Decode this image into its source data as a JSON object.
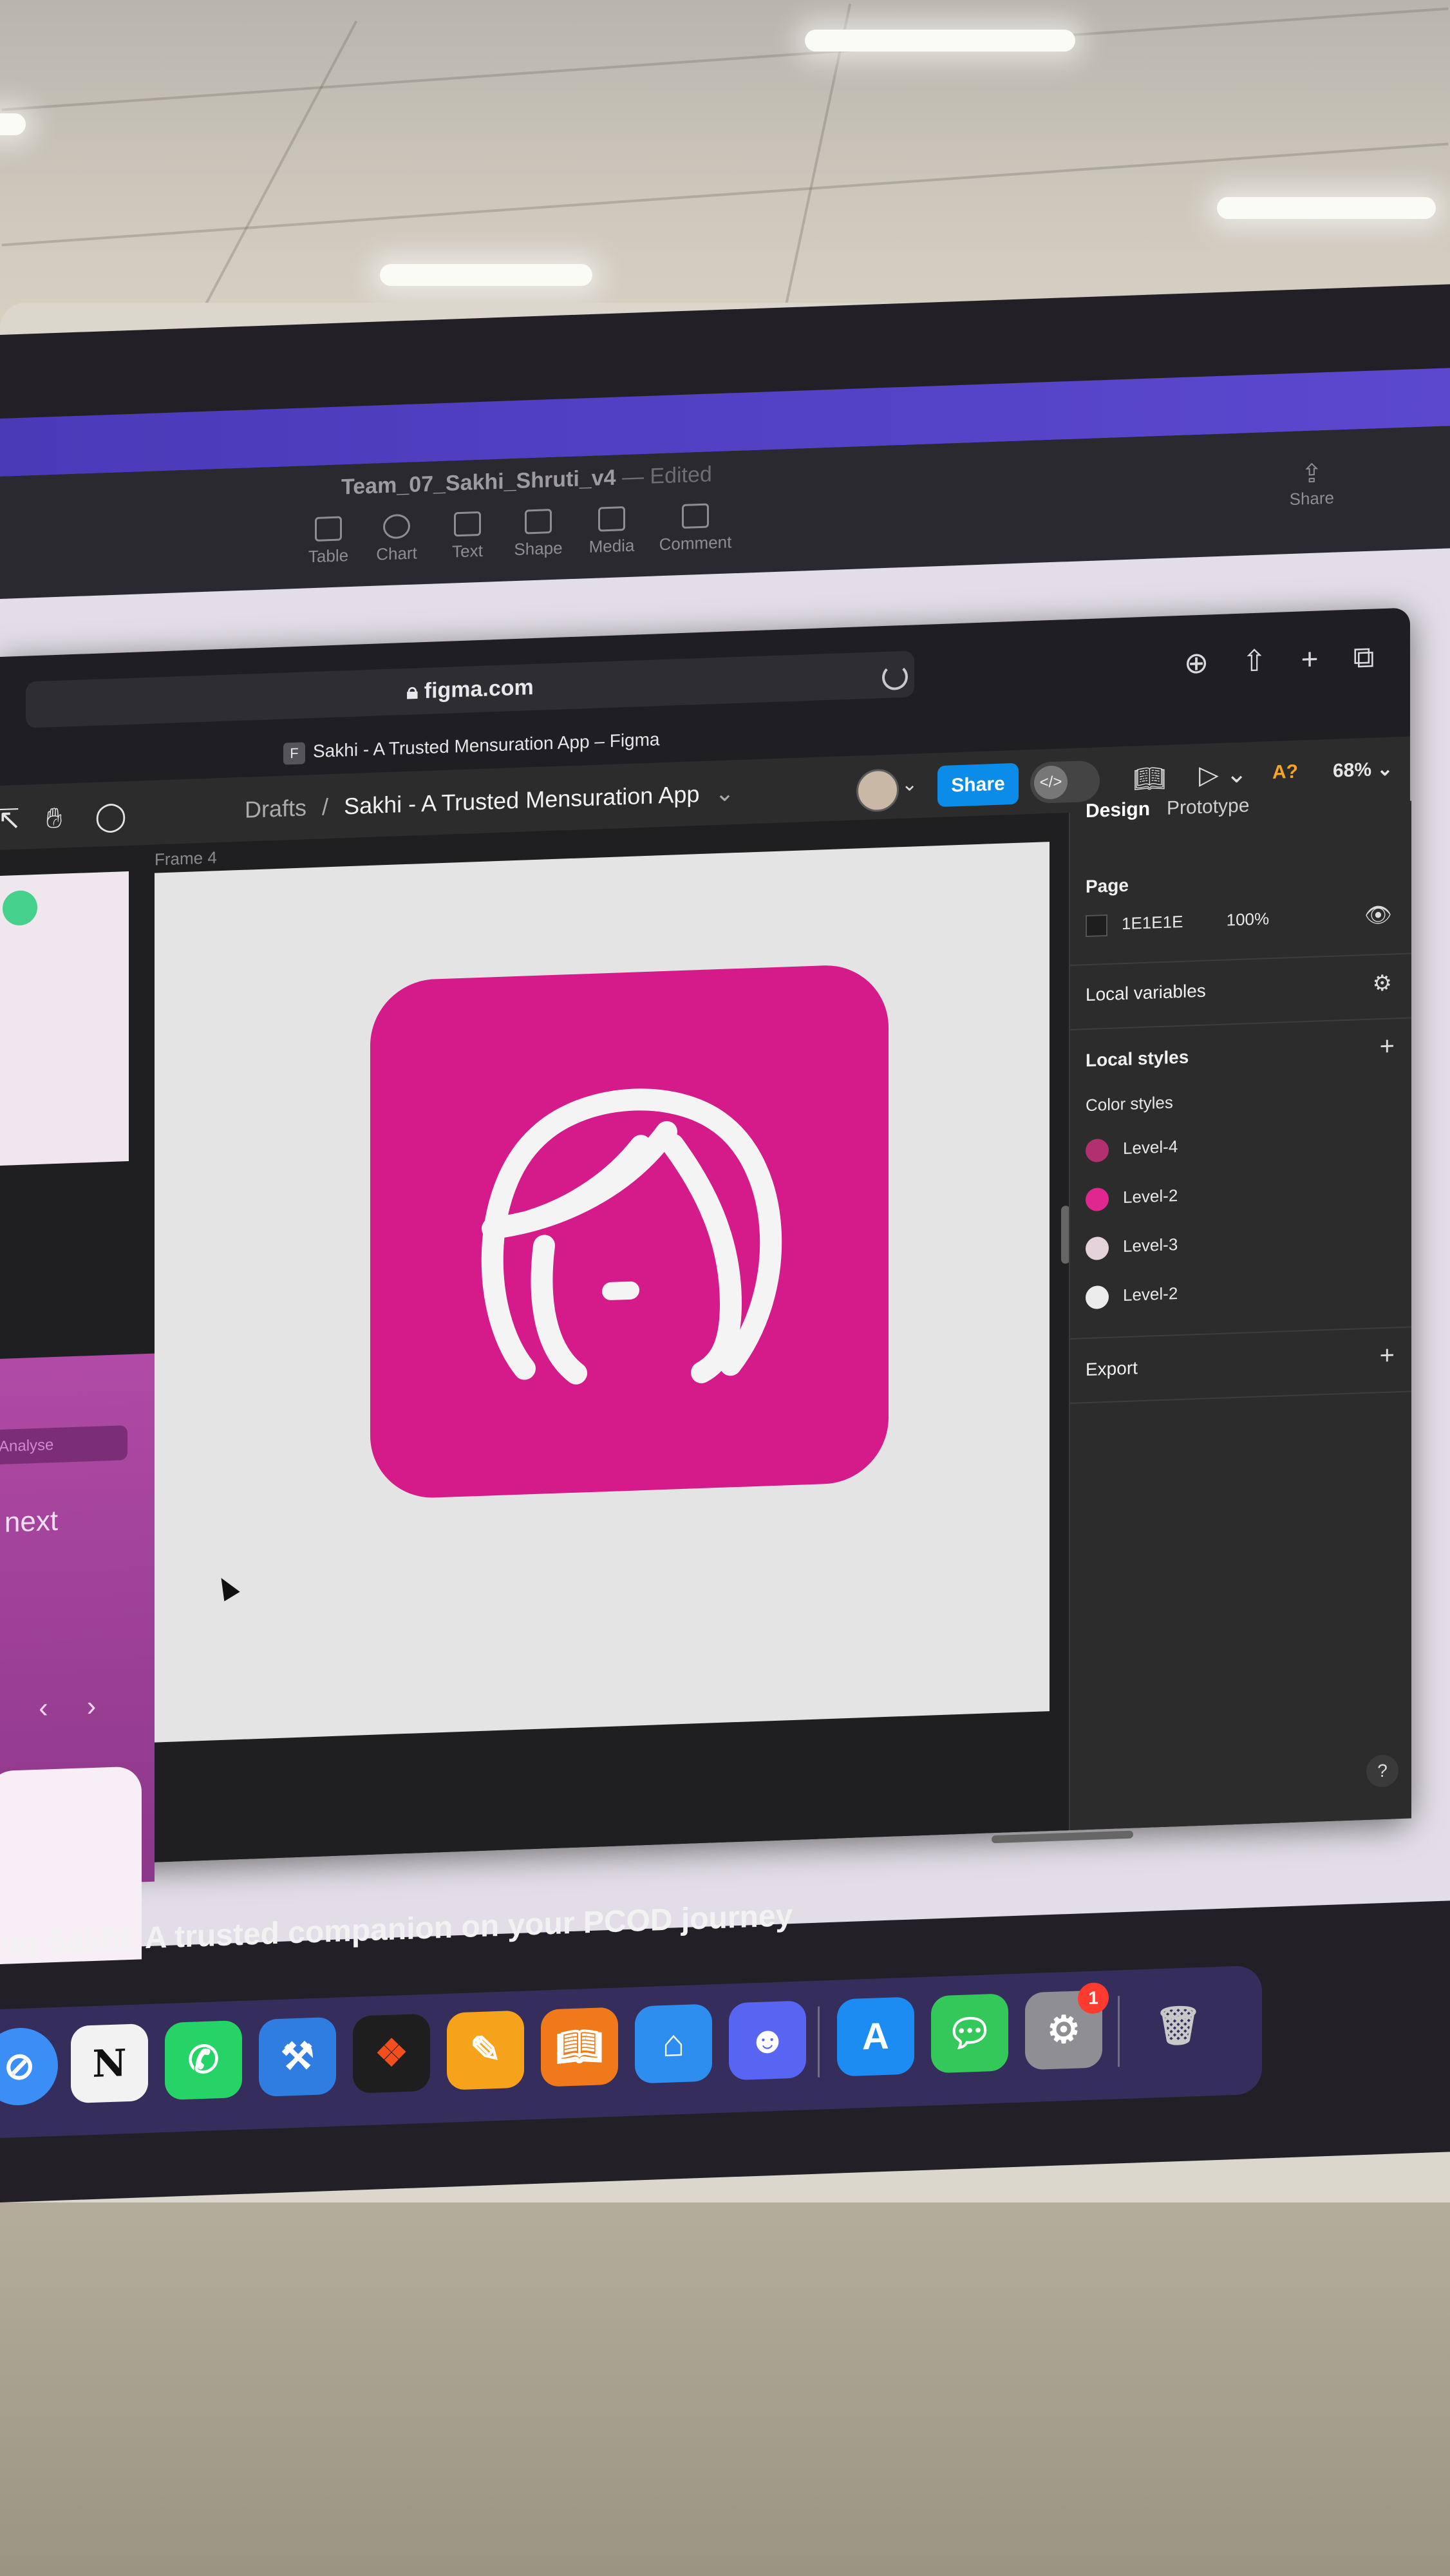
{
  "numbers_app": {
    "doc_title": "Team_07_Sakhi_Shruti_v4",
    "edited_label": "— Edited",
    "toolbar": [
      "Table",
      "Chart",
      "Text",
      "Shape",
      "Media",
      "Comment"
    ],
    "share_label": "Share"
  },
  "browser": {
    "url": "figma.com",
    "tab_title": "Sakhi - A Trusted Mensuration App – Figma",
    "tab_favicon": "F"
  },
  "figma": {
    "breadcrumb_root": "Drafts",
    "breadcrumb_sep": "/",
    "file_name": "Sakhi - A Trusted Mensuration App",
    "share_label": "Share",
    "ai_label": "A?",
    "zoom": "68%",
    "frame_label": "Frame 4",
    "app_icon_color": "#d51a8a",
    "side_phone": {
      "pill_text": "Analyse",
      "text": "r next"
    },
    "panel": {
      "tabs": [
        "Design",
        "Prototype"
      ],
      "page_title": "Page",
      "page_color": "1E1E1E",
      "page_opacity": "100%",
      "local_variables": "Local variables",
      "local_styles": "Local styles",
      "color_styles": "Color styles",
      "styles": [
        {
          "name": "Level-4",
          "color": "#b2306f"
        },
        {
          "name": "Level-2",
          "color": "#e0268f"
        },
        {
          "name": "Level-3",
          "color": "#e5d3dc"
        },
        {
          "name": "Level-2",
          "color": "#ececec"
        }
      ],
      "export": "Export",
      "help": "?"
    }
  },
  "caption": "ng Sakhi, A trusted companion on your PCOD journey",
  "dock": {
    "messages_badge": "1"
  }
}
